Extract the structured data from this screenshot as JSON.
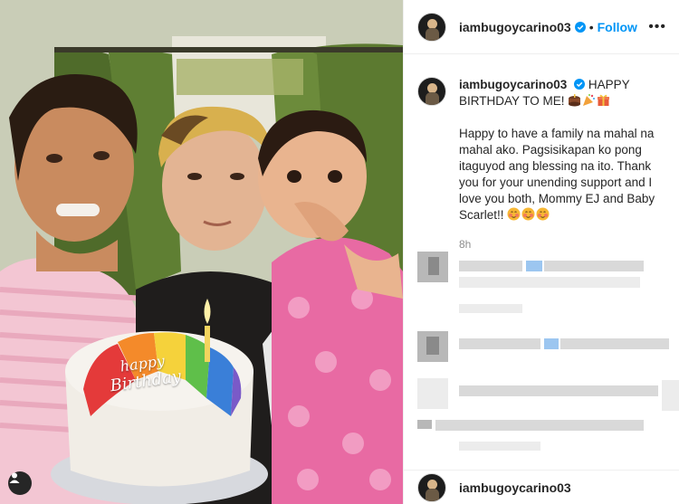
{
  "post": {
    "username": "iambugoycarino03",
    "separator": "•",
    "follow_label": "Follow",
    "more_label": "•••",
    "caption_username": "iambugoycarino03",
    "caption_line1": "HAPPY BIRTHDAY TO ME!",
    "caption_body": "Happy to have a family na mahal na mahal ako. Pagsisikapan ko pong itaguyod ang blessing na ito. Thank you for your unending support and I love you both, Mommy EJ and Baby Scarlet!!",
    "time": "8h",
    "footer_username": "iambugoycarino03"
  },
  "cake": {
    "line1": "happy",
    "line2": "Birthday"
  },
  "icons": {
    "verified": "verified-badge-icon",
    "cake": "cake-emoji-icon",
    "party": "party-popper-emoji-icon",
    "gift": "gift-emoji-icon",
    "smile": "blushing-face-emoji-icon",
    "user": "user-tag-icon"
  },
  "colors": {
    "link": "#0095f6",
    "verified": "#0095f6",
    "muted": "#8e8e8e"
  }
}
